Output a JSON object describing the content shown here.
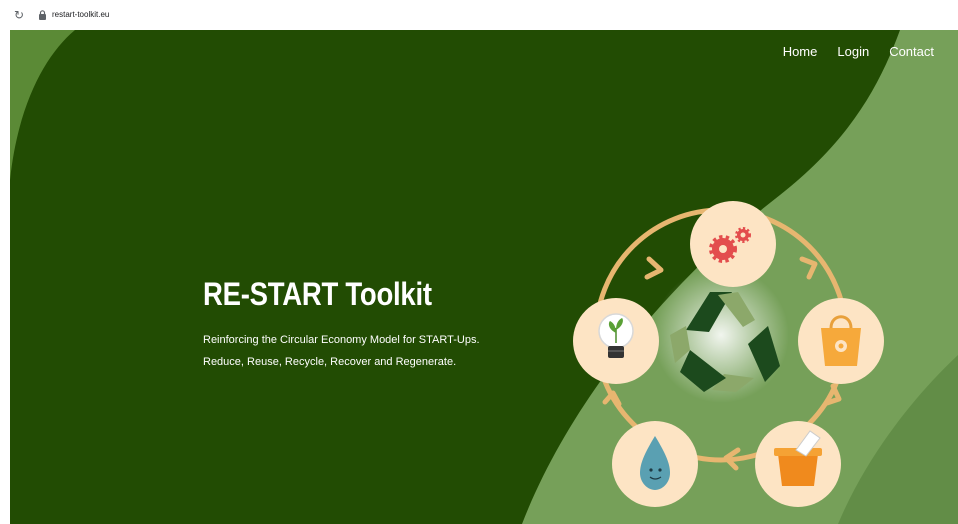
{
  "browser": {
    "url": "restart-toolkit.eu",
    "icons": {
      "reload": "reload-icon",
      "lock": "lock-icon"
    }
  },
  "nav": {
    "items": [
      {
        "label": "Home"
      },
      {
        "label": "Login"
      },
      {
        "label": "Contact"
      }
    ]
  },
  "hero": {
    "title": "RE-START Toolkit",
    "tagline_1": "Reinforcing the Circular Economy Model for START-Ups.",
    "tagline_2": "Reduce, Reuse, Recycle, Recover and Regenerate."
  },
  "colors": {
    "dark_green": "#224c03",
    "light_green": "#76a059",
    "circle_bg": "#fde4c4",
    "arrow": "#e7b670"
  },
  "cycle_icons": [
    "gears-icon",
    "shopping-bag-icon",
    "recycle-bin-icon",
    "water-drop-icon",
    "lightbulb-plant-icon",
    "recycle-symbol-icon"
  ]
}
